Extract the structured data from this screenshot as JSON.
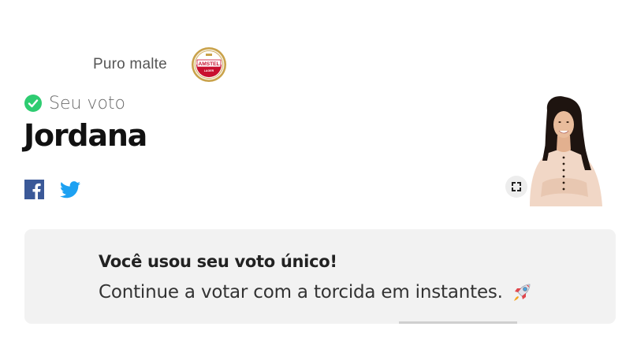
{
  "sponsor": {
    "label": "Puro malte",
    "logo_text": "AMSTEL",
    "logo_subtext": "LAGER",
    "logo_icon": "amstel-logo",
    "brand_color": "#c8102e"
  },
  "vote": {
    "status_label": "Seu voto",
    "status_icon": "check-circle-icon",
    "status_color": "#2ecc71",
    "candidate": "Jordana"
  },
  "share": {
    "facebook_icon": "facebook-icon",
    "facebook_color": "#3b5998",
    "twitter_icon": "twitter-icon",
    "twitter_color": "#1da1f2"
  },
  "photo": {
    "icon": "candidate-photo",
    "fullscreen_icon": "expand-icon"
  },
  "message": {
    "title": "Você usou seu voto único!",
    "body": "Continue a votar com a torcida em instantes.",
    "emoji_icon": "rocket-icon"
  }
}
